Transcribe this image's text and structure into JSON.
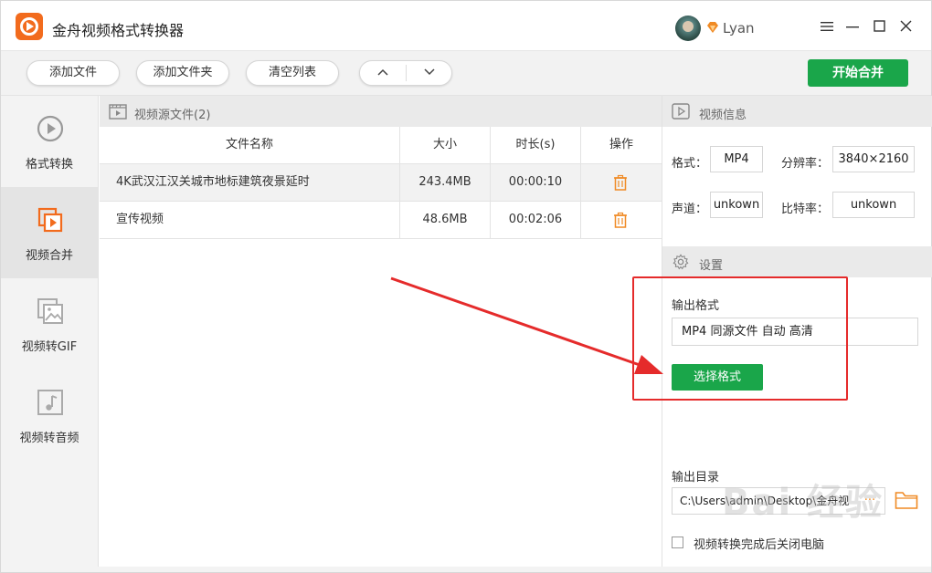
{
  "app": {
    "title": "金舟视频格式转换器",
    "username": "Lyan"
  },
  "window": {
    "menu_icon": "menu-icon",
    "min_icon": "minimize-icon",
    "max_icon": "maximize-icon",
    "close_icon": "close-icon"
  },
  "toolbar": {
    "add_file": "添加文件",
    "add_folder": "添加文件夹",
    "clear_list": "清空列表",
    "move_up": "︿",
    "move_down": "﹀",
    "start_merge": "开始合并"
  },
  "sidebar": {
    "items": [
      {
        "label": "格式转换",
        "icon": "play-circle-icon",
        "active": false
      },
      {
        "label": "视频合并",
        "icon": "merge-icon",
        "active": true
      },
      {
        "label": "视频转GIF",
        "icon": "image-icon",
        "active": false
      },
      {
        "label": "视频转音频",
        "icon": "music-icon",
        "active": false
      }
    ]
  },
  "files": {
    "header_title": "视频源文件(2)",
    "columns": [
      "文件名称",
      "大小",
      "时长(s)",
      "操作"
    ],
    "rows": [
      {
        "name": "4K武汉江汉关城市地标建筑夜景延时",
        "size": "243.4MB",
        "duration": "00:00:10"
      },
      {
        "name": "宣传视频",
        "size": "48.6MB",
        "duration": "00:02:06"
      }
    ]
  },
  "video_info": {
    "header_title": "视频信息",
    "format_label": "格式：",
    "format_value": "MP4",
    "resolution_label": "分辨率：",
    "resolution_value": "3840×2160",
    "channel_label": "声道：",
    "channel_value": "unkown",
    "bitrate_label": "比特率：",
    "bitrate_value": "unkown"
  },
  "settings": {
    "header_title": "设置",
    "output_format_label": "输出格式",
    "output_format_value": "MP4 同源文件 自动 高清",
    "choose_format_button": "选择格式",
    "output_dir_label": "输出目录",
    "output_dir_value": "C:\\Users\\admin\\Desktop\\金舟视",
    "dir_more": "···",
    "close_after_label": "视频转换完成后关闭电脑"
  },
  "watermark": "Bai 经验",
  "colors": {
    "accent_green": "#1aa64a",
    "brand_orange": "#f26b1d",
    "annotation_red": "#e52b2b"
  }
}
